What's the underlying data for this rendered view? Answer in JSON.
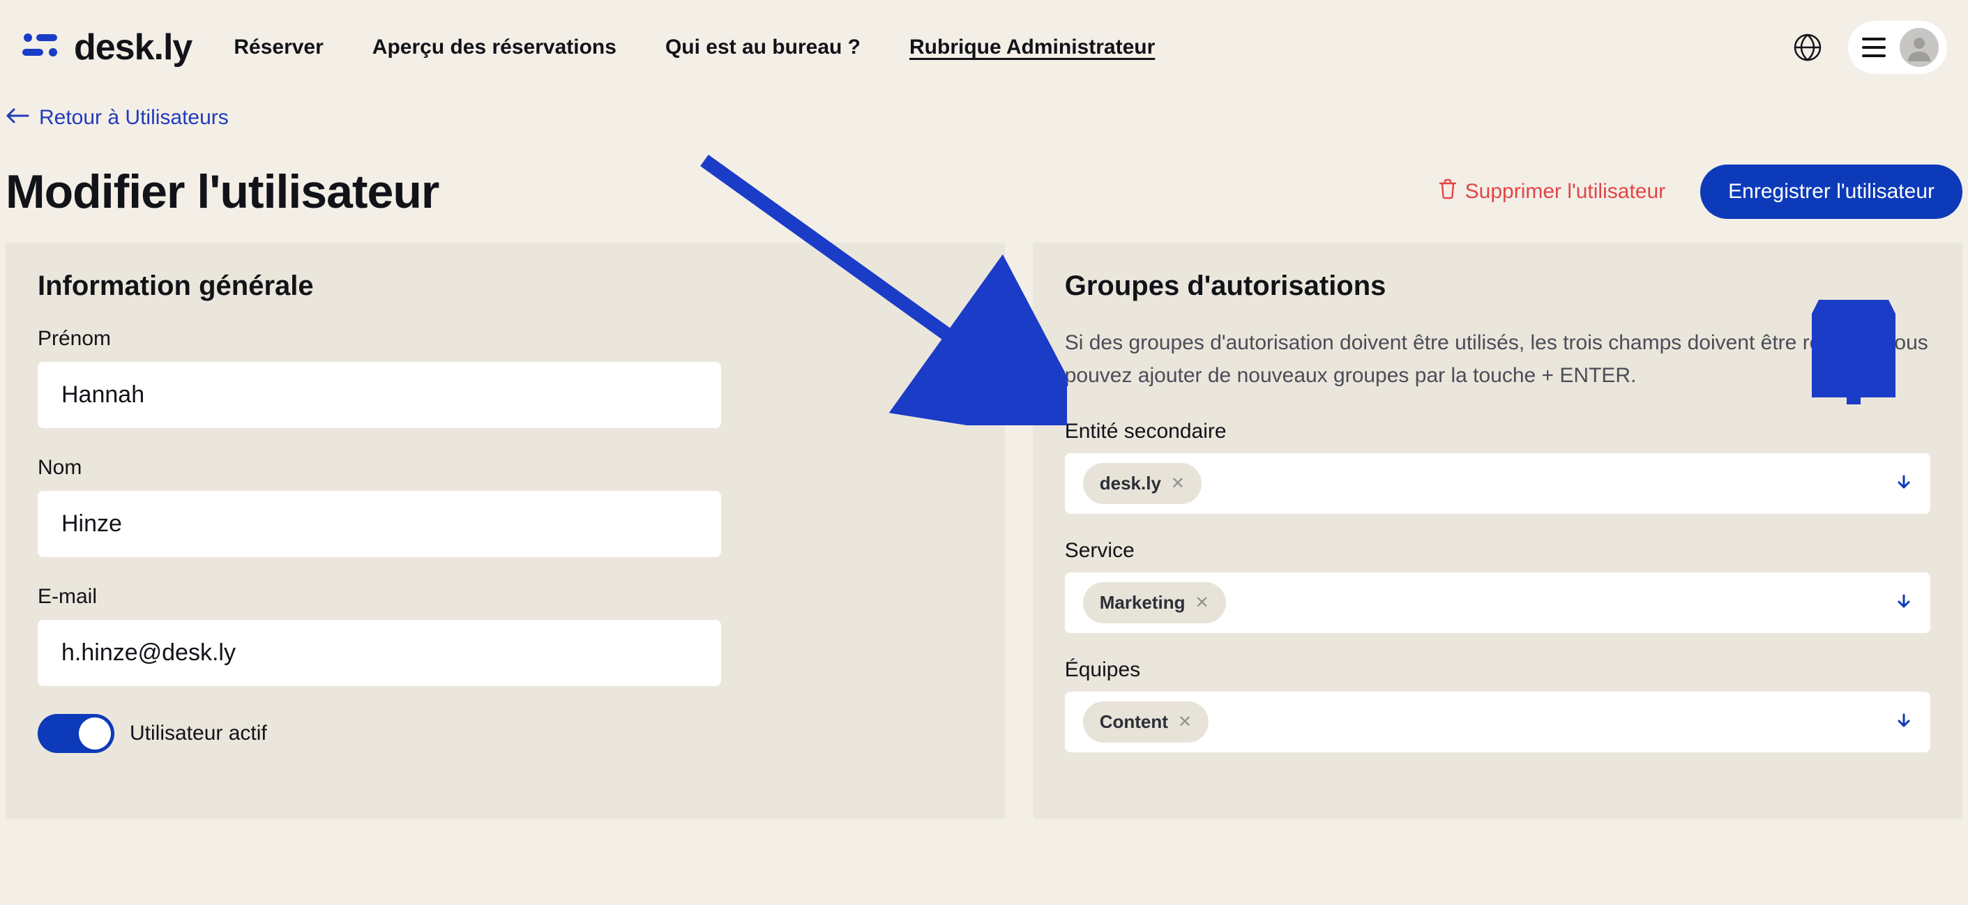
{
  "brand": {
    "name": "desk.ly"
  },
  "nav": {
    "reserve": "Réserver",
    "overview": "Aperçu des réservations",
    "office": "Qui est au bureau ?",
    "admin": "Rubrique Administrateur"
  },
  "back": {
    "label": "Retour à Utilisateurs"
  },
  "page": {
    "title": "Modifier l'utilisateur"
  },
  "actions": {
    "delete": "Supprimer l'utilisateur",
    "save": "Enregistrer l'utilisateur"
  },
  "left": {
    "title": "Information générale",
    "firstname_label": "Prénom",
    "firstname_value": "Hannah",
    "lastname_label": "Nom",
    "lastname_value": "Hinze",
    "email_label": "E-mail",
    "email_value": "h.hinze@desk.ly",
    "active_label": "Utilisateur actif"
  },
  "right": {
    "title": "Groupes d'autorisations",
    "desc": "Si des groupes d'autorisation doivent être utilisés, les trois champs doivent être remplis. Vous pouvez ajouter de nouveaux groupes par la touche + ENTER.",
    "entity_label": "Entité secondaire",
    "entity_chip": "desk.ly",
    "service_label": "Service",
    "service_chip": "Marketing",
    "teams_label": "Équipes",
    "teams_chip": "Content"
  }
}
